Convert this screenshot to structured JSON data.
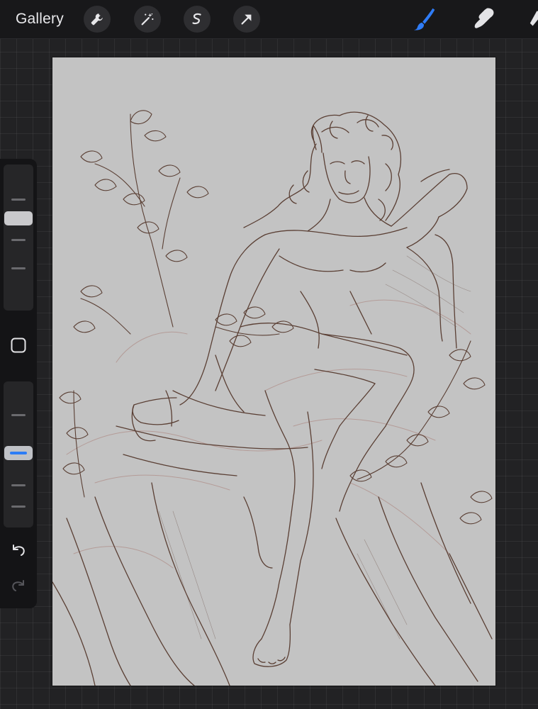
{
  "toolbar": {
    "gallery_label": "Gallery",
    "left_tools": [
      {
        "name": "wrench-icon"
      },
      {
        "name": "magic-wand-icon"
      },
      {
        "name": "selection-s-icon"
      },
      {
        "name": "transform-arrow-icon"
      }
    ],
    "right_tools": [
      {
        "name": "brush-icon",
        "active": true,
        "color": "#2f7cf6"
      },
      {
        "name": "smudge-icon",
        "active": false
      },
      {
        "name": "eraser-icon",
        "active": false
      }
    ]
  },
  "sidebar": {
    "brush_size_value": 0.5,
    "opacity_value": 0.5,
    "buttons": [
      "square-modify-icon",
      "undo-icon",
      "redo-icon"
    ]
  },
  "colors": {
    "accent": "#2f7cf6",
    "canvas": "#c3c3c3",
    "sketch_line": "#5a3f34",
    "sketch_under": "#a87b74"
  }
}
